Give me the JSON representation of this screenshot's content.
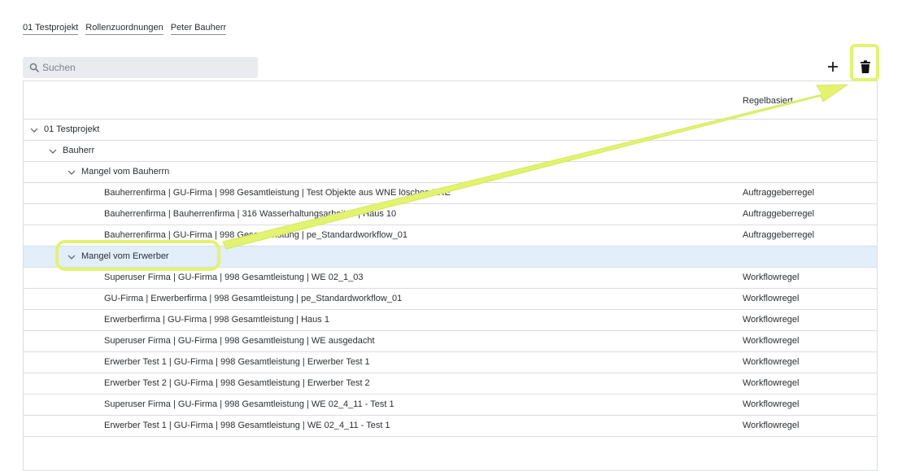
{
  "breadcrumb": [
    "01 Testprojekt",
    "Rollenzuordnungen",
    "Peter Bauherr"
  ],
  "search": {
    "placeholder": "Suchen",
    "value": ""
  },
  "toolbar": {
    "add_icon": "plus-icon",
    "delete_icon": "trash-icon"
  },
  "table": {
    "column_header": "Regelbasiert",
    "rows": [
      {
        "level": 0,
        "label": "01 Testprojekt",
        "type": "",
        "expanded": true
      },
      {
        "level": 1,
        "label": "Bauherr",
        "type": "",
        "expanded": true
      },
      {
        "level": 2,
        "label": "Mangel vom Bauherrn",
        "type": "",
        "expanded": true
      },
      {
        "level": 3,
        "label": "Bauherrenfirma | GU-Firma | 998 Gesamtleistung | Test Objekte aus WNE löschen KRE",
        "type": "Auftraggeberregel"
      },
      {
        "level": 3,
        "label": "Bauherrenfirma | Bauherrenfirma | 316 Wasserhaltungsarbeiten | Haus 10",
        "type": "Auftraggeberregel"
      },
      {
        "level": 3,
        "label": "Bauherrenfirma | GU-Firma | 998 Gesamtleistung | pe_Standardworkflow_01",
        "type": "Auftraggeberregel"
      },
      {
        "level": 2,
        "label": "Mangel vom Erwerber",
        "type": "",
        "expanded": true,
        "selected": true
      },
      {
        "level": 3,
        "label": "Superuser Firma | GU-Firma | 998 Gesamtleistung | WE 02_1_03",
        "type": "Workflowregel"
      },
      {
        "level": 3,
        "label": "GU-Firma | Erwerberfirma | 998 Gesamtleistung | pe_Standardworkflow_01",
        "type": "Workflowregel"
      },
      {
        "level": 3,
        "label": "Erwerberfirma | GU-Firma | 998 Gesamtleistung | Haus 1",
        "type": "Workflowregel"
      },
      {
        "level": 3,
        "label": "Superuser Firma | GU-Firma | 998 Gesamtleistung | WE ausgedacht",
        "type": "Workflowregel"
      },
      {
        "level": 3,
        "label": "Erwerber Test 1 | GU-Firma | 998 Gesamtleistung | Erwerber Test 1",
        "type": "Workflowregel"
      },
      {
        "level": 3,
        "label": "Erwerber Test 2 | GU-Firma | 998 Gesamtleistung | Erwerber Test 2",
        "type": "Workflowregel"
      },
      {
        "level": 3,
        "label": "Superuser Firma | GU-Firma | 998 Gesamtleistung | WE 02_4_11 - Test 1",
        "type": "Workflowregel"
      },
      {
        "level": 3,
        "label": "Erwerber Test 1 | GU-Firma | 998 Gesamtleistung | WE 02_4_11 - Test 1",
        "type": "Workflowregel"
      }
    ]
  },
  "annotation": {
    "color": "#e2f36f"
  }
}
